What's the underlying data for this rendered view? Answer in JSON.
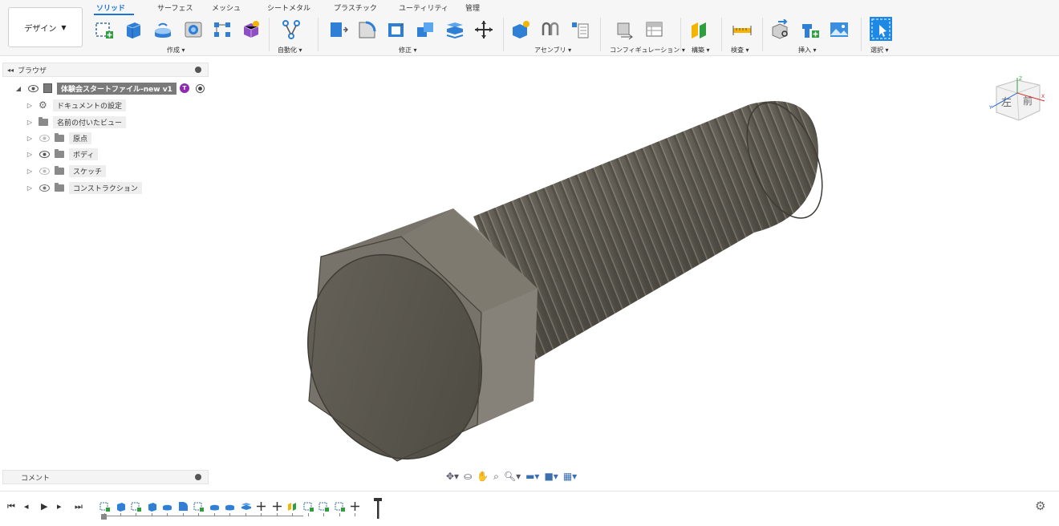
{
  "workspace": {
    "label": "デザイン"
  },
  "tabs": [
    "ソリッド",
    "サーフェス",
    "メッシュ",
    "シートメタル",
    "プラスチック",
    "ユーティリティ",
    "管理"
  ],
  "groups": {
    "create": "作成 ▾",
    "automate": "自動化 ▾",
    "modify": "修正 ▾",
    "assemble": "アセンブリ ▾",
    "configure": "コンフィギュレーション ▾",
    "construct": "構築 ▾",
    "inspect": "検査 ▾",
    "insert": "挿入 ▾",
    "select": "選択 ▾"
  },
  "browser": {
    "title": "ブラウザ",
    "root": {
      "label": "体験会スタートファイル-new v1",
      "badge": "T"
    },
    "items": [
      {
        "label": "ドキュメントの設定"
      },
      {
        "label": "名前の付いたビュー"
      },
      {
        "label": "原点"
      },
      {
        "label": "ボディ"
      },
      {
        "label": "スケッチ"
      },
      {
        "label": "コンストラクション"
      }
    ]
  },
  "comments": {
    "title": "コメント"
  },
  "viewcube": {
    "left": "左",
    "front": "前",
    "axis_z": "Z",
    "axis_x": "X",
    "axis_y": "Y"
  },
  "colors": {
    "accent": "#1a73d9",
    "bolt": "#6e6a60",
    "bolt_head_face": "#5e5a50",
    "select_box": "#1e88e5"
  },
  "icons": {
    "navbar": [
      "orbit-icon",
      "look-at-icon",
      "pan-icon",
      "zoom-fit-icon",
      "zoom-icon",
      "display-settings-icon",
      "visual-style-icon",
      "grid-icon"
    ],
    "playback": [
      "first-frame-icon",
      "previous-icon",
      "play-icon",
      "next-icon",
      "last-frame-icon"
    ]
  }
}
